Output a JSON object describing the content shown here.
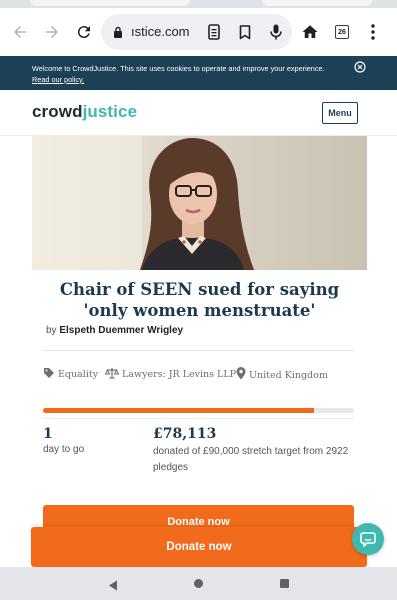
{
  "browser": {
    "url_text": "ıstice.com",
    "tab_count": "26"
  },
  "cookie_banner": {
    "text": "Welcome to CrowdJustice. This site uses cookies to operate and improve your experience.",
    "link": "Read our policy."
  },
  "site": {
    "logo_part1": "crowd",
    "logo_part2": "justice",
    "menu_label": "Menu",
    "brand_color": "#3fb8b0",
    "accent_color": "#f26a1b",
    "dark_color": "#1c4056"
  },
  "campaign": {
    "title": "Chair of SEEN sued for saying 'only women menstruate'",
    "by_label": "by",
    "author": "Elspeth Duemmer Wrigley",
    "tags": [
      {
        "icon": "tag-icon",
        "label": "Equality"
      },
      {
        "icon": "scales-icon",
        "label": "Lawyers: JR Levins LLP"
      },
      {
        "icon": "location-pin-icon",
        "label": "United Kingdom"
      }
    ],
    "progress_fraction": 0.87,
    "days_value": "1",
    "days_label": "day to go",
    "amount_value": "£78,113",
    "amount_label": "donated of £90,000 stretch target from 2922 pledges"
  },
  "actions": {
    "donate_label": "Donate now",
    "chat_icon": "chat-bubble-icon"
  },
  "android_nav": {
    "back_icon": "back-triangle-icon",
    "home_icon": "home-circle-icon",
    "recents_icon": "recents-square-icon"
  }
}
